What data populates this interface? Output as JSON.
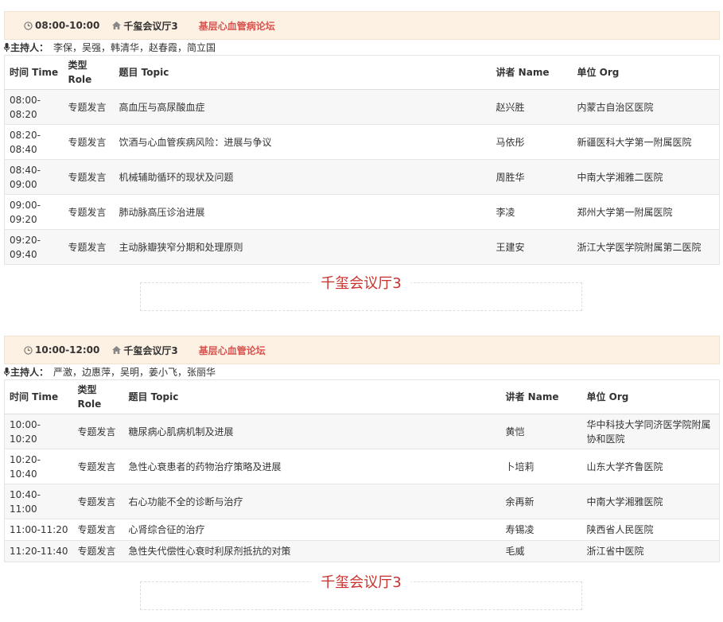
{
  "sessions": [
    {
      "time": "08:00-10:00",
      "room": "千玺会议厅3",
      "topic": "基层心血管病论坛",
      "hosts_label": "主持人：",
      "hosts": "李保，吴强，韩清华，赵春霞，简立国",
      "headers": {
        "time_a": "时间 Time",
        "role_a": "类型",
        "role_b": "Role",
        "topic": "题目 Topic",
        "speaker": "讲者 Name",
        "org": "单位 Org"
      },
      "rows": [
        {
          "time_a": "08:00-",
          "time_b": "08:20",
          "role": "专题发言",
          "topic": "高血压与高尿酸血症",
          "speaker": "赵兴胜",
          "org": "内蒙古自治区医院"
        },
        {
          "time_a": "08:20-",
          "time_b": "08:40",
          "role": "专题发言",
          "topic": "饮酒与心血管疾病风险：进展与争议",
          "speaker": "马依彤",
          "org": "新疆医科大学第一附属医院"
        },
        {
          "time_a": "08:40-",
          "time_b": "09:00",
          "role": "专题发言",
          "topic": "机械辅助循环的现状及问题",
          "speaker": "周胜华",
          "org": "中南大学湘雅二医院"
        },
        {
          "time_a": "09:00-",
          "time_b": "09:20",
          "role": "专题发言",
          "topic": "肺动脉高压诊治进展",
          "speaker": "李凌",
          "org": "郑州大学第一附属医院"
        },
        {
          "time_a": "09:20-",
          "time_b": "09:40",
          "role": "专题发言",
          "topic": "主动脉瓣狭窄分期和处理原则",
          "speaker": "王建安",
          "org": "浙江大学医学院附属第二医院"
        }
      ],
      "banner": "千玺会议厅3"
    },
    {
      "time": "10:00-12:00",
      "room": "千玺会议厅3",
      "topic": "基层心血管论坛",
      "hosts_label": "主持人：",
      "hosts": "严激，边惠萍，吴明，姜小飞，张丽华",
      "headers": {
        "time_a": "时间 Time",
        "role_a": "类型",
        "role_b": "Role",
        "topic": "题目 Topic",
        "speaker": "讲者 Name",
        "org": "单位 Org"
      },
      "rows": [
        {
          "time_a": "10:00-",
          "time_b": "10:20",
          "role": "专题发言",
          "topic": "糖尿病心肌病机制及进展",
          "speaker": "黄恺",
          "org": "华中科技大学同济医学院附属协和医院"
        },
        {
          "time_a": "10:20-",
          "time_b": "10:40",
          "role": "专题发言",
          "topic": "急性心衰患者的药物治疗策略及进展",
          "speaker": "卜培莉",
          "org": "山东大学齐鲁医院"
        },
        {
          "time_a": "10:40-",
          "time_b": "11:00",
          "role": "专题发言",
          "topic": "右心功能不全的诊断与治疗",
          "speaker": "余再新",
          "org": "中南大学湘雅医院"
        },
        {
          "time_a": "11:00-11:20",
          "time_b": "",
          "role": "专题发言",
          "topic": "心肾综合征的治疗",
          "speaker": "寿锡凌",
          "org": "陕西省人民医院"
        },
        {
          "time_a": "11:20-11:40",
          "time_b": "",
          "role": "专题发言",
          "topic": "急性失代偿性心衰时利尿剂抵抗的对策",
          "speaker": "毛威",
          "org": "浙江省中医院"
        }
      ],
      "banner": "千玺会议厅3"
    }
  ],
  "icons": {
    "clock": "clock-icon",
    "home": "home-icon",
    "mic": "microphone-icon"
  },
  "colors": {
    "header_bg": "#fdf1e4",
    "accent_red": "#d9534f",
    "banner_red": "#c9302c"
  }
}
